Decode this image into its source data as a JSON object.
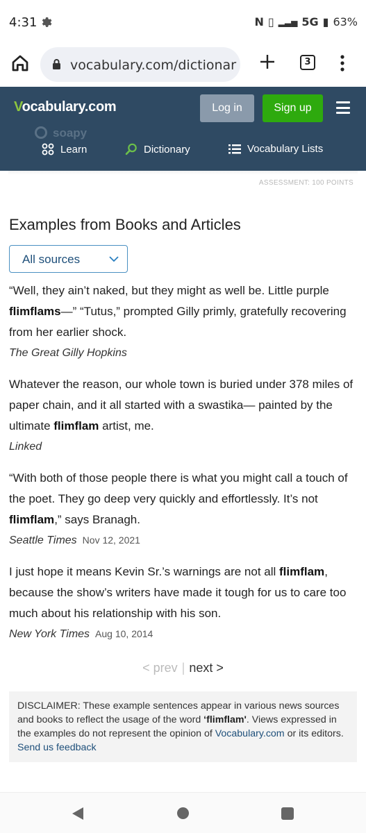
{
  "status_bar": {
    "time": "4:31",
    "indicators": "5G",
    "battery": "63%",
    "icons": [
      "gear-icon",
      "nfc-icon",
      "vibrate-icon",
      "signal-icon",
      "battery-icon"
    ]
  },
  "browser": {
    "url": "vocabulary.com/dictionary/",
    "tab_count": "3",
    "icons": [
      "home-icon",
      "lock-icon",
      "plus-icon",
      "tabs-icon",
      "menu-dots-icon"
    ]
  },
  "site_header": {
    "logo_v": "V",
    "logo_rest": "ocabulary.com",
    "login_label": "Log in",
    "signup_label": "Sign up",
    "search_ghost": "soapy",
    "nav": [
      {
        "label": "Learn",
        "icon": "learn-icon"
      },
      {
        "label": "Dictionary",
        "icon": "search-icon"
      },
      {
        "label": "Vocabulary Lists",
        "icon": "list-icon"
      }
    ],
    "colors": {
      "header": "#2f4a63",
      "signup": "#2eaa0e",
      "login": "#8a9aab",
      "logo_accent": "#8dc63f"
    }
  },
  "assessment_label": "ASSESSMENT: 100 POINTS",
  "main": {
    "section_title": "Examples from Books and Articles",
    "source_filter": "All sources",
    "examples": [
      {
        "before": "“Well, they ain’t naked, but they might as well be. Little purple ",
        "bold": "flimflams",
        "after": "—” “Tutus,” prompted Gilly primly, gratefully recovering from her earlier shock.",
        "source": "The Great Gilly Hopkins",
        "date": ""
      },
      {
        "before": "Whatever the reason, our whole town is buried under 378 miles of paper chain, and it all started with a swastika— painted by the ultimate ",
        "bold": "flimflam",
        "after": " artist, me.",
        "source": "Linked",
        "date": ""
      },
      {
        "before": "“With both of those people there is what you might call a touch of the poet. They go deep very quickly and effortlessly. It’s not ",
        "bold": "flimflam",
        "after": ",” says Branagh.",
        "source": "Seattle Times",
        "date": "Nov 12, 2021"
      },
      {
        "before": "I just hope it means Kevin Sr.’s warnings are not all ",
        "bold": "flimflam",
        "after": ", because the show’s writers have made it tough for us to care too much about his relationship with his son.",
        "source": "New York Times",
        "date": "Aug 10, 2014"
      }
    ],
    "pager": {
      "prev": "< prev",
      "separator": "|",
      "next": "next >"
    },
    "disclaimer": {
      "text1": "DISCLAIMER: These example sentences appear in various news sources and books to reflect the usage of the word ",
      "word": "‘flimflam'",
      "text2": ". Views expressed in the examples do not represent the opinion of ",
      "link1": "Vocabulary.com",
      "text3": " or its editors. ",
      "link2": "Send us feedback"
    }
  },
  "system_nav": {
    "icons": [
      "back-icon",
      "home-circle-icon",
      "recents-icon"
    ]
  }
}
